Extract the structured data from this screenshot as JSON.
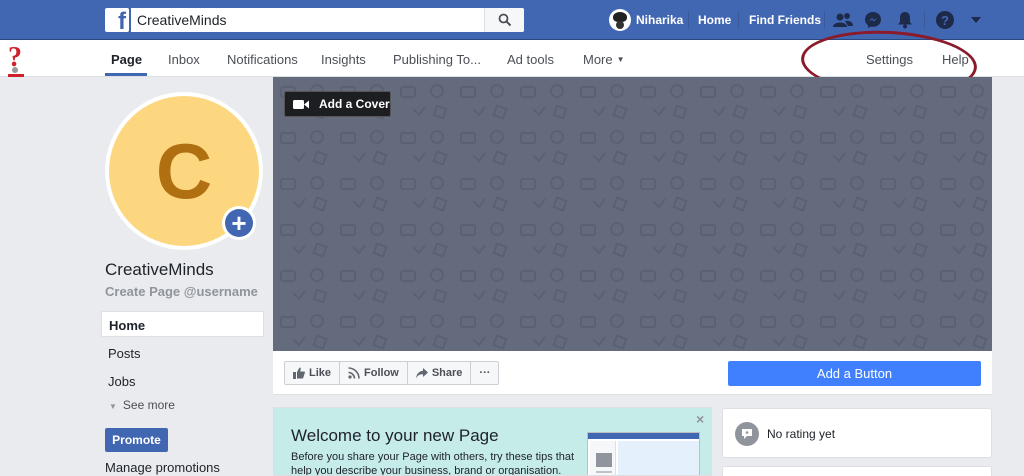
{
  "topbar": {
    "search_value": "CreativeMinds",
    "user_name": "Niharika",
    "home_label": "Home",
    "find_friends_label": "Find Friends",
    "icons": [
      "facebook-logo-icon",
      "search-icon",
      "friend-requests-icon",
      "messenger-icon",
      "notifications-icon",
      "help-icon",
      "account-caret-icon"
    ]
  },
  "pagenav": {
    "items": [
      {
        "label": "Page",
        "active": true
      },
      {
        "label": "Inbox"
      },
      {
        "label": "Notifications"
      },
      {
        "label": "Insights"
      },
      {
        "label": "Publishing To..."
      },
      {
        "label": "Ad tools"
      },
      {
        "label": "More"
      }
    ],
    "settings_label": "Settings",
    "help_label": "Help"
  },
  "profile": {
    "initial": "C",
    "name": "CreativeMinds",
    "handle": "Create Page @username"
  },
  "sidebar": {
    "items": [
      {
        "label": "Home",
        "active": true
      },
      {
        "label": "Posts"
      },
      {
        "label": "Jobs"
      }
    ],
    "see_more_label": "See more",
    "promote_label": "Promote",
    "manage_promotions_label": "Manage promotions"
  },
  "cover": {
    "add_cover_label": "Add a Cover"
  },
  "actions": {
    "like_label": "Like",
    "follow_label": "Follow",
    "share_label": "Share",
    "more_label": "···",
    "add_button_label": "Add a Button"
  },
  "welcome": {
    "title": "Welcome to your new Page",
    "text": "Before you share your Page with others, try these tips that help you describe your business, brand or organisation.",
    "close": "×"
  },
  "rating": {
    "text": "No rating yet"
  },
  "colors": {
    "brand_blue": "#4267b2",
    "cta_blue": "#4080ff",
    "cover_gray": "#646b7d",
    "avatar_yellow": "#fdd77f",
    "avatar_letter": "#b06f11",
    "welcome_teal": "#c6ecea",
    "annotation": "#8b1a2a"
  }
}
